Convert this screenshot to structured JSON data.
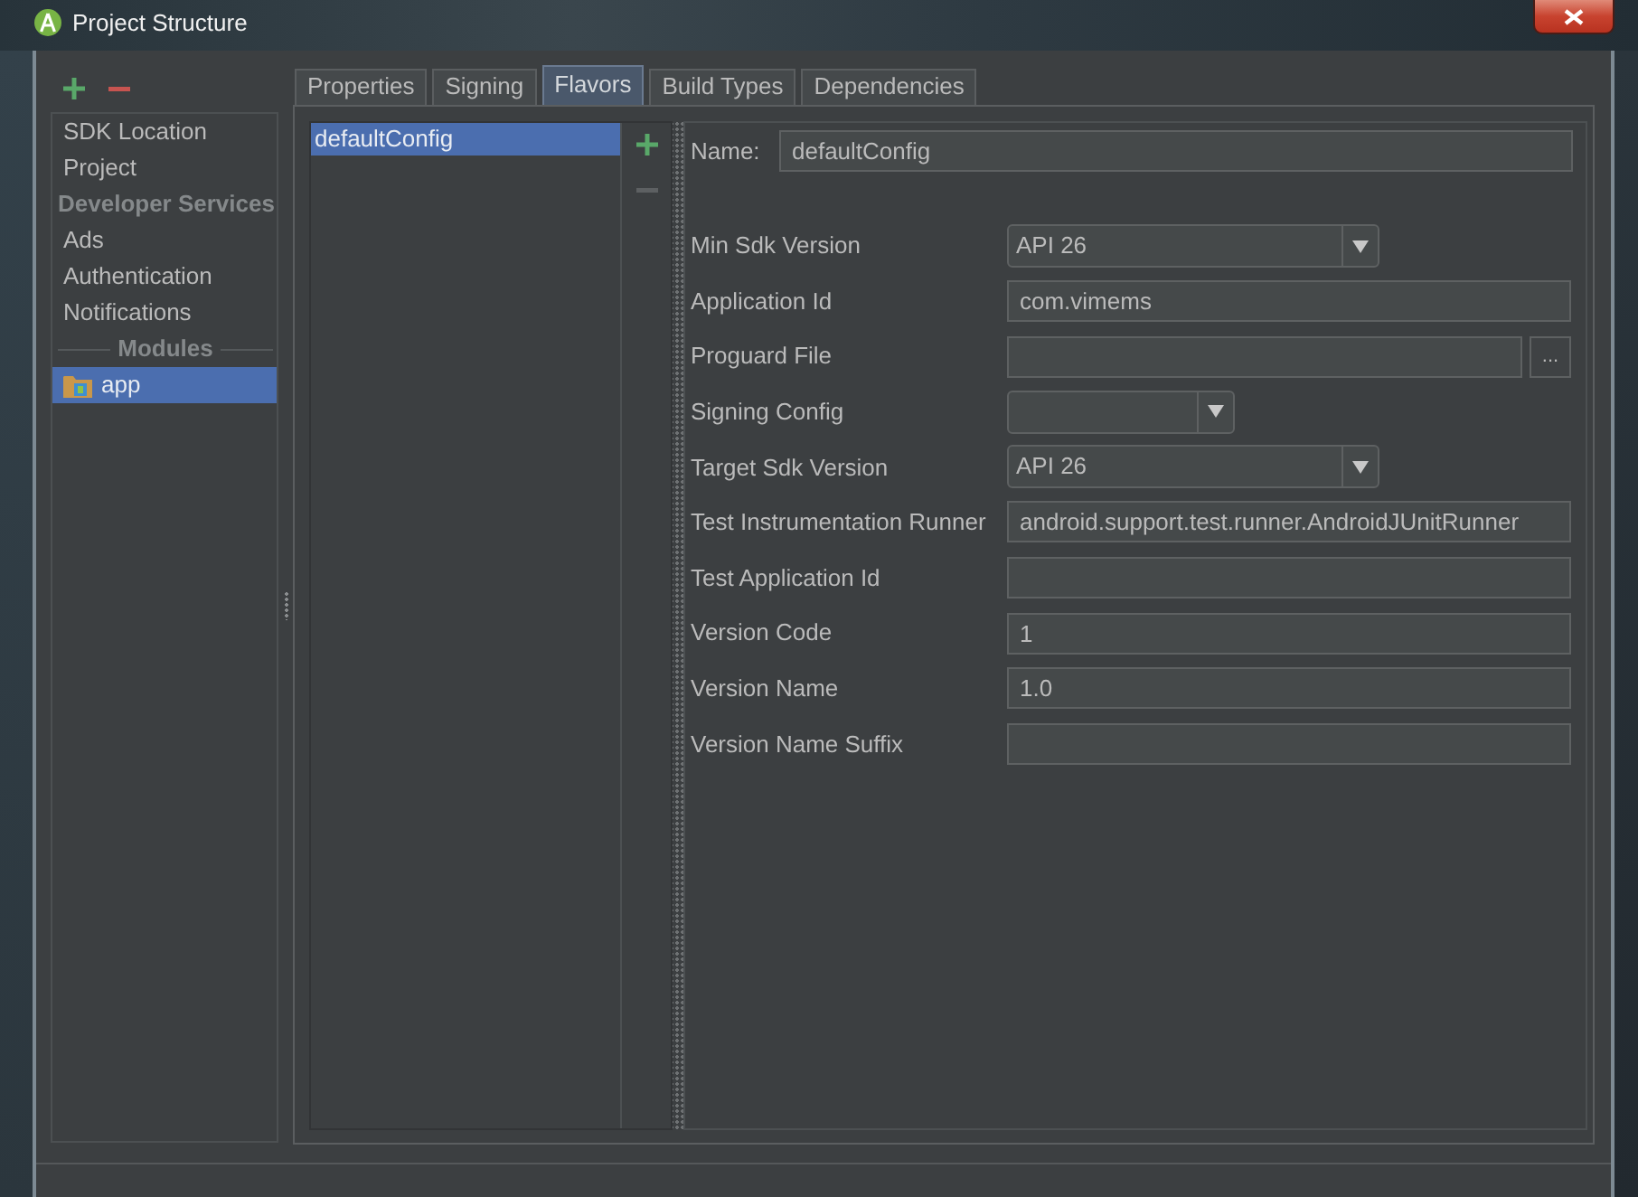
{
  "window": {
    "title": "Project Structure"
  },
  "sidebar": {
    "actions": [
      {
        "kind": "add",
        "disabled": false
      },
      {
        "kind": "remove",
        "disabled": false
      }
    ],
    "items": [
      {
        "kind": "item",
        "label": "SDK Location",
        "selected": false
      },
      {
        "kind": "item",
        "label": "Project",
        "selected": false
      },
      {
        "kind": "header",
        "label": "Developer Services"
      },
      {
        "kind": "item",
        "label": "Ads",
        "selected": false
      },
      {
        "kind": "item",
        "label": "Authentication",
        "selected": false
      },
      {
        "kind": "item",
        "label": "Notifications",
        "selected": false
      },
      {
        "kind": "separator",
        "label": "Modules"
      },
      {
        "kind": "module",
        "label": "app",
        "selected": true
      }
    ]
  },
  "tabs": [
    {
      "label": "Properties",
      "selected": false
    },
    {
      "label": "Signing",
      "selected": false
    },
    {
      "label": "Flavors",
      "selected": true
    },
    {
      "label": "Build Types",
      "selected": false
    },
    {
      "label": "Dependencies",
      "selected": false
    }
  ],
  "flavors": {
    "items": [
      {
        "label": "defaultConfig",
        "selected": true
      }
    ],
    "actions": [
      {
        "kind": "add",
        "disabled": false
      },
      {
        "kind": "remove",
        "disabled": true
      }
    ]
  },
  "form": {
    "name": {
      "label": "Name:",
      "value": "defaultConfig"
    },
    "fields": [
      {
        "kind": "combo",
        "label": "Min Sdk Version",
        "value": "API 26"
      },
      {
        "kind": "text",
        "label": "Application Id",
        "value": "com.vimems"
      },
      {
        "kind": "file",
        "label": "Proguard File",
        "button": "..."
      },
      {
        "kind": "combo",
        "label": "Signing Config"
      },
      {
        "kind": "combo",
        "label": "Target Sdk Version",
        "value": "API 26"
      },
      {
        "kind": "text",
        "label": "Test Instrumentation Runner",
        "value": "android.support.test.runner.AndroidJUnitRunner"
      },
      {
        "kind": "text",
        "label": "Test Application Id"
      },
      {
        "kind": "text",
        "label": "Version Code",
        "value": "1"
      },
      {
        "kind": "text",
        "label": "Version Name",
        "value": "1.0"
      },
      {
        "kind": "text",
        "label": "Version Name Suffix"
      }
    ]
  }
}
